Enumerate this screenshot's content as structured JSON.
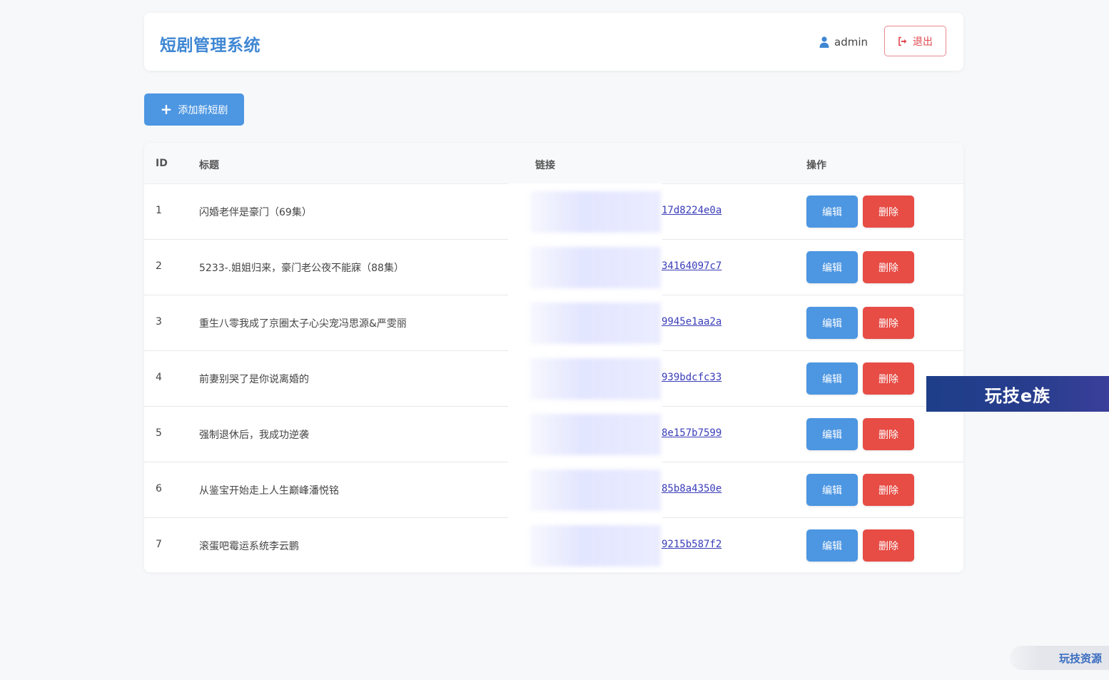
{
  "header": {
    "brand": "短剧管理系统",
    "user_name": "admin",
    "logout_label": "退出"
  },
  "toolbar": {
    "add_label": "添加新短剧"
  },
  "table": {
    "columns": [
      "ID",
      "标题",
      "链接",
      "操作"
    ],
    "rows": [
      {
        "id": "1",
        "title": "闪婚老伴是豪门（69集）",
        "link": "17d8224e0a",
        "edit": "编辑",
        "delete": "删除"
      },
      {
        "id": "2",
        "title": "5233-.姐姐归来，豪门老公夜不能寐（88集）",
        "link": "34164097c7",
        "edit": "编辑",
        "delete": "删除"
      },
      {
        "id": "3",
        "title": "重生八零我成了京圈太子心尖宠冯思源&严雯丽",
        "link": "9945e1aa2a",
        "edit": "编辑",
        "delete": "删除"
      },
      {
        "id": "4",
        "title": "前妻别哭了是你说离婚的",
        "link": "939bdcfc33",
        "edit": "编辑",
        "delete": "删除"
      },
      {
        "id": "5",
        "title": "强制退休后，我成功逆袭",
        "link": "8e157b7599",
        "edit": "编辑",
        "delete": "删除"
      },
      {
        "id": "6",
        "title": "从鉴宝开始走上人生巅峰潘悦铭",
        "link": "85b8a4350e",
        "edit": "编辑",
        "delete": "删除"
      },
      {
        "id": "7",
        "title": "滚蛋吧霉运系统李云鹏",
        "link": "9215b587f2",
        "edit": "编辑",
        "delete": "删除"
      }
    ]
  },
  "watermarks": {
    "overlay": "玩技e族",
    "corner": "玩技资源"
  },
  "colors": {
    "primary": "#4c96e2",
    "danger": "#e74c45",
    "brand": "#3f87d3",
    "link": "#3a3db8"
  }
}
